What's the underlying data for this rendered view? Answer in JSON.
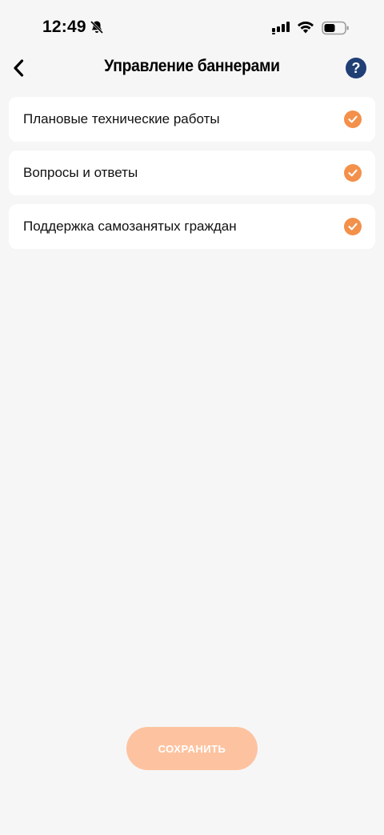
{
  "status_bar": {
    "time": "12:49",
    "icons": [
      "bell-slash-icon",
      "signal-icon",
      "wifi-icon",
      "battery-icon"
    ]
  },
  "header": {
    "back_icon": "chevron-left-icon",
    "title": "Управление баннерами",
    "help_label": "?"
  },
  "banners": [
    {
      "label": "Плановые технические работы",
      "checked": true
    },
    {
      "label": "Вопросы и ответы",
      "checked": true
    },
    {
      "label": "Поддержка самозанятых граждан",
      "checked": true
    }
  ],
  "save_button": {
    "label": "СОХРАНИТЬ"
  },
  "colors": {
    "background": "#f6f6f7",
    "accent": "#f3904a",
    "help_badge": "#1f3f75",
    "save_button": "#fdc3a0"
  }
}
